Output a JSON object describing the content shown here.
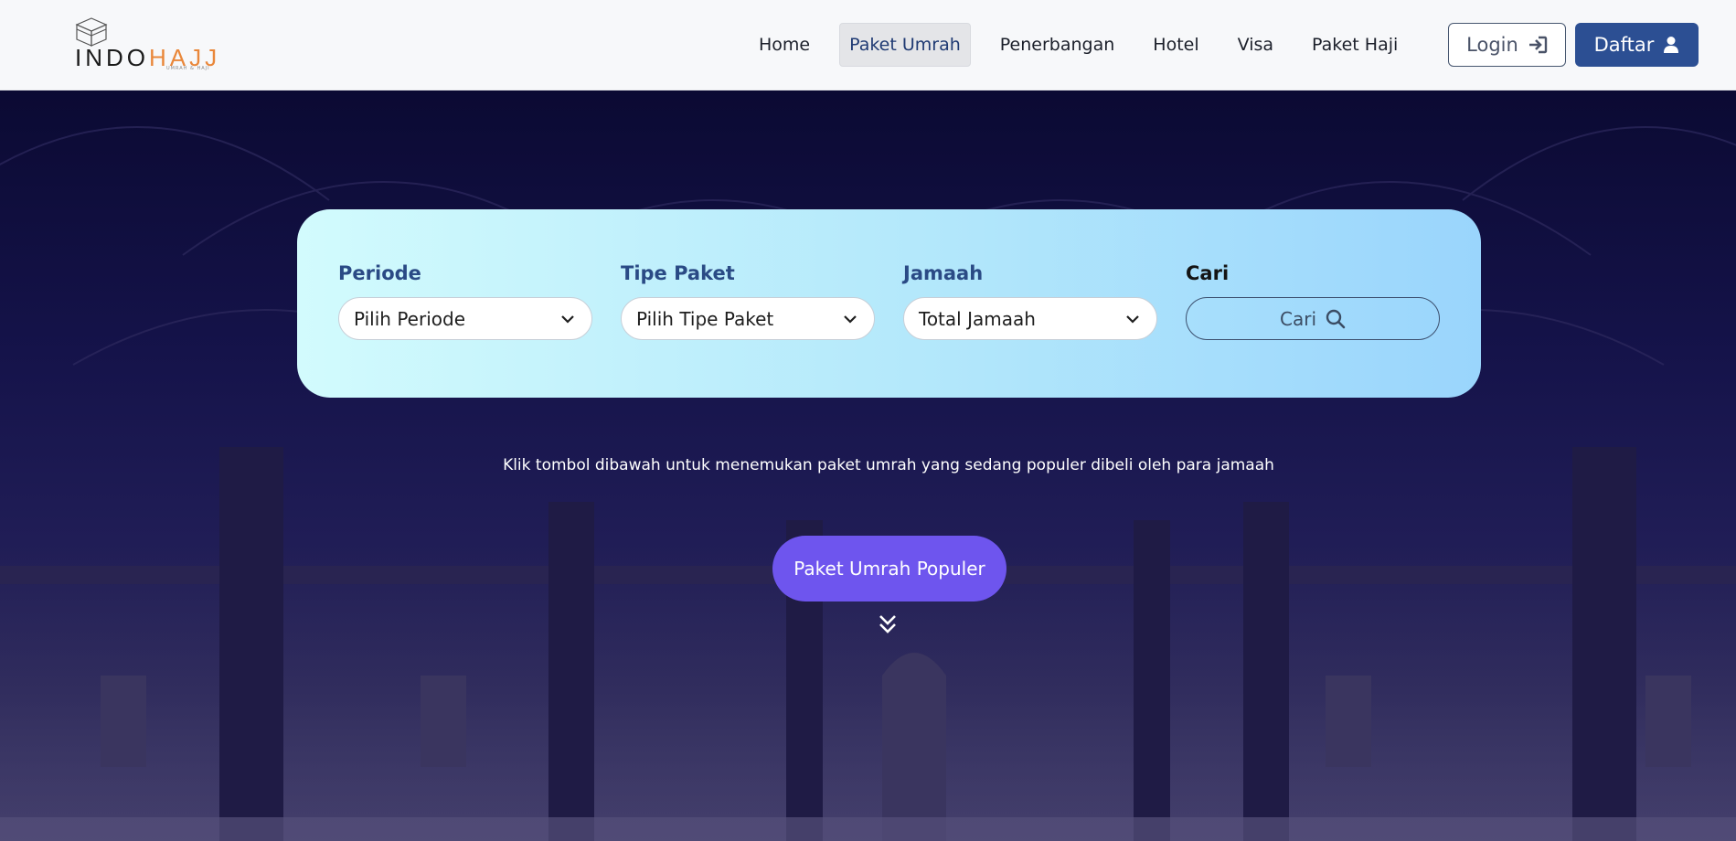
{
  "brand": {
    "name_part1": "INDO",
    "name_part2": "HAJJ",
    "tagline": "UMRAH & HAJI",
    "accent_color": "#e9873a"
  },
  "nav": {
    "items": [
      {
        "label": "Home",
        "active": false
      },
      {
        "label": "Paket Umrah",
        "active": true
      },
      {
        "label": "Penerbangan",
        "active": false
      },
      {
        "label": "Hotel",
        "active": false
      },
      {
        "label": "Visa",
        "active": false
      },
      {
        "label": "Paket Haji",
        "active": false
      }
    ],
    "login_label": "Login",
    "login_icon": "sign-in-icon",
    "register_label": "Daftar",
    "register_icon": "user-icon",
    "register_color": "#2c4f93"
  },
  "search": {
    "periode": {
      "label": "Periode",
      "value": "Pilih Periode"
    },
    "tipe_paket": {
      "label": "Tipe Paket",
      "value": "Pilih Tipe Paket"
    },
    "jamaah": {
      "label": "Jamaah",
      "value": "Total Jamaah"
    },
    "cari": {
      "label": "Cari",
      "button_label": "Cari",
      "icon": "search-icon"
    }
  },
  "hero": {
    "description": "Klik tombol dibawah untuk menemukan paket umrah yang sedang populer dibeli oleh para jamaah",
    "popular_button_label": "Paket Umrah Populer",
    "popular_button_color": "#6e55ee",
    "scroll_icon": "double-chevron-down-icon"
  }
}
